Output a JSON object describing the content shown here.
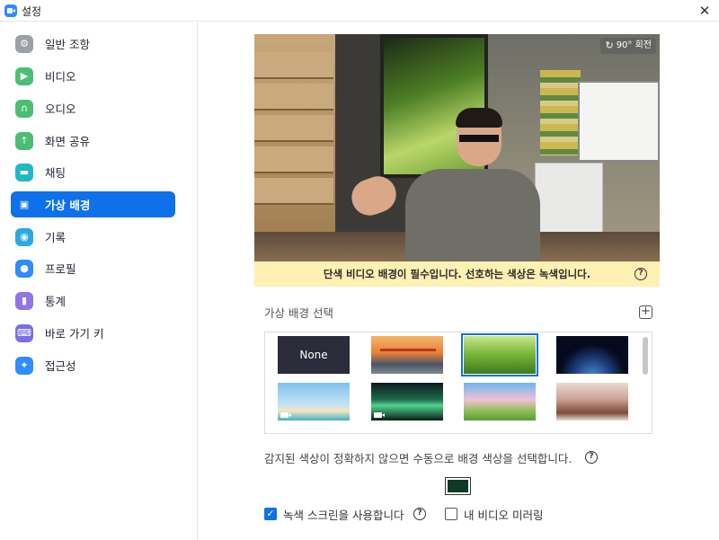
{
  "window": {
    "title": "설정",
    "close_label": "✕"
  },
  "sidebar": {
    "items": [
      {
        "label": "일반 조항",
        "icon": "gear-icon",
        "color": "#9aa0a6"
      },
      {
        "label": "비디오",
        "icon": "video-icon",
        "color": "#4cbe73"
      },
      {
        "label": "오디오",
        "icon": "headphones-icon",
        "color": "#4cbe73"
      },
      {
        "label": "화면 공유",
        "icon": "share-screen-icon",
        "color": "#4cbe73"
      },
      {
        "label": "채팅",
        "icon": "chat-icon",
        "color": "#1fb9c6"
      },
      {
        "label": "가상 배경",
        "icon": "person-icon",
        "color": "#0e71eb",
        "active": true
      },
      {
        "label": "기록",
        "icon": "record-icon",
        "color": "#2aa9e0"
      },
      {
        "label": "프로필",
        "icon": "profile-icon",
        "color": "#2d8cff"
      },
      {
        "label": "통계",
        "icon": "statistics-icon",
        "color": "#8f75e8"
      },
      {
        "label": "바로 가기 키",
        "icon": "keyboard-icon",
        "color": "#7a6ee6"
      },
      {
        "label": "접근성",
        "icon": "accessibility-icon",
        "color": "#2d8cff"
      }
    ]
  },
  "preview": {
    "rotate_label": "90° 회전",
    "warning_text": "단색 비디오 배경이 필수입니다. 선호하는 색상은 녹색입니다."
  },
  "background_section": {
    "label": "가상 배경 선택",
    "add_label": "+",
    "thumbnails": [
      {
        "label": "None",
        "type": "none"
      },
      {
        "label": "",
        "type": "bridge"
      },
      {
        "label": "",
        "type": "grass",
        "selected": true
      },
      {
        "label": "",
        "type": "earth"
      },
      {
        "label": "",
        "type": "beach",
        "video": true
      },
      {
        "label": "",
        "type": "aurora",
        "video": true
      },
      {
        "label": "",
        "type": "blossom"
      },
      {
        "label": "",
        "type": "cherry"
      }
    ]
  },
  "manual_color": {
    "text": "감지된 색상이 정확하지 않으면 수동으로 배경 색상을 선택합니다.",
    "swatch_color": "#0b3a27"
  },
  "options": {
    "green_screen_label": "녹색 스크린을 사용합니다",
    "green_screen_checked": true,
    "mirror_label": "내 비디오 미러링",
    "mirror_checked": false
  },
  "help_label": "?"
}
